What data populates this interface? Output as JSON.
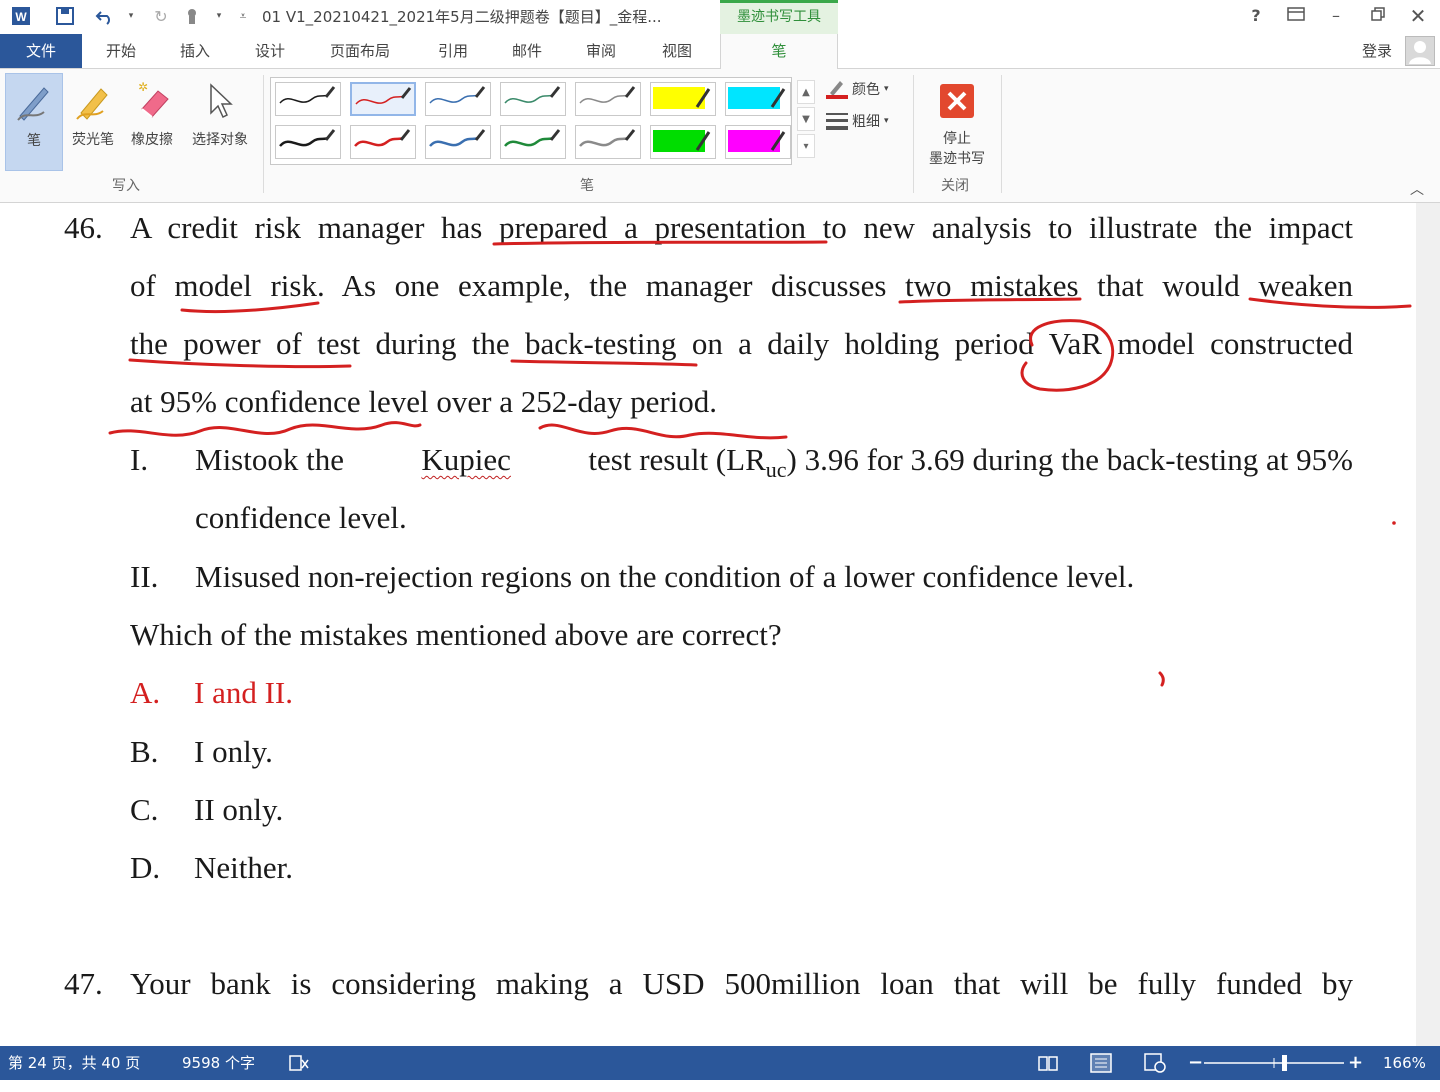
{
  "titlebar": {
    "doc_title": "01 V1_20210421_2021年5月二级押题卷【题目】_金程...",
    "context_tab": "墨迹书写工具"
  },
  "menu": {
    "file": "文件",
    "items": [
      "开始",
      "插入",
      "设计",
      "页面布局",
      "引用",
      "邮件",
      "审阅",
      "视图"
    ],
    "active_tab": "笔",
    "login": "登录"
  },
  "ribbon": {
    "write_group": {
      "label": "写入",
      "buttons": [
        "笔",
        "荧光笔",
        "橡皮擦",
        "选择对象"
      ]
    },
    "pens_group": {
      "label": "笔",
      "color_label": "颜色",
      "weight_label": "粗细",
      "swatches_row1": [
        "#1a1a1a",
        "#d42020",
        "#3a6fb0",
        "#3a8a6a",
        "#8a8a8a",
        "#ffff00",
        "#00e5ff"
      ],
      "swatches_row2": [
        "#1a1a1a",
        "#d42020",
        "#3a6fb0",
        "#1f8a3a",
        "#8a8a8a",
        "#00dd00",
        "#ff00ff"
      ]
    },
    "close_group": {
      "label": "关闭",
      "stop_label_1": "停止",
      "stop_label_2": "墨迹书写"
    }
  },
  "document": {
    "q46": {
      "number": "46.",
      "lines": [
        "A credit risk manager has prepared a presentation to new analysis to illustrate the impact",
        "of model risk. As one example, the manager discusses two mistakes that would weaken",
        "the power of test during the back-testing on a daily holding period VaR model constructed",
        "at 95% confidence level over a 252-day period."
      ],
      "item1_label": "I.",
      "item1_pre": "Mistook the",
      "item1_kupiec": "Kupiec",
      "item1_mid": "test result (LR",
      "item1_sub": "uc",
      "item1_post": ") 3.96 for 3.69 during the back-testing at 95%",
      "item1_cont": "confidence level.",
      "item2_label": "II.",
      "item2_text": "Misused non-rejection regions on the condition of a lower confidence level.",
      "question": "Which of the mistakes mentioned above are correct?",
      "options": [
        {
          "letter": "A.",
          "text": "I and II."
        },
        {
          "letter": "B.",
          "text": "I only."
        },
        {
          "letter": "C.",
          "text": "II only."
        },
        {
          "letter": "D.",
          "text": "Neither."
        }
      ]
    },
    "q47": {
      "number": "47.",
      "line": "Your bank is considering making a USD 500million loan that will be fully funded by"
    }
  },
  "statusbar": {
    "page": "第 24 页，共 40 页",
    "words": "9598 个字",
    "zoom": "166%"
  },
  "colors": {
    "word_blue": "#2b579a",
    "ink_red": "#d42020",
    "ink_context_green": "#3aa84a"
  }
}
